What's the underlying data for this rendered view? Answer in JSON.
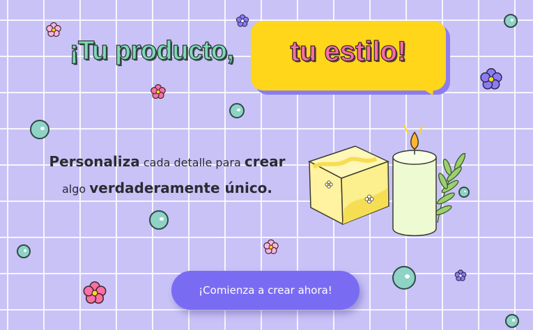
{
  "hero": {
    "title_part1": "¡Tu producto,",
    "title_part2": "tu estilo!"
  },
  "subtitle": {
    "word1": "Personaliza",
    "word2": "cada detalle para",
    "word3": "crear",
    "word4": "algo",
    "word5": "verdaderamente único."
  },
  "cta": {
    "label": "¡Comienza a crear ahora!"
  },
  "colors": {
    "background": "#c9c2f7",
    "title_green": "#7fd9b7",
    "bubble_yellow": "#ffd61a",
    "bubble_text_pink": "#ff6fa3",
    "button_purple": "#7a6cf2",
    "bead_teal": "#8fd3c6"
  },
  "illustration": {
    "items": [
      "soap-bar",
      "candle",
      "leaf-sprig"
    ]
  }
}
